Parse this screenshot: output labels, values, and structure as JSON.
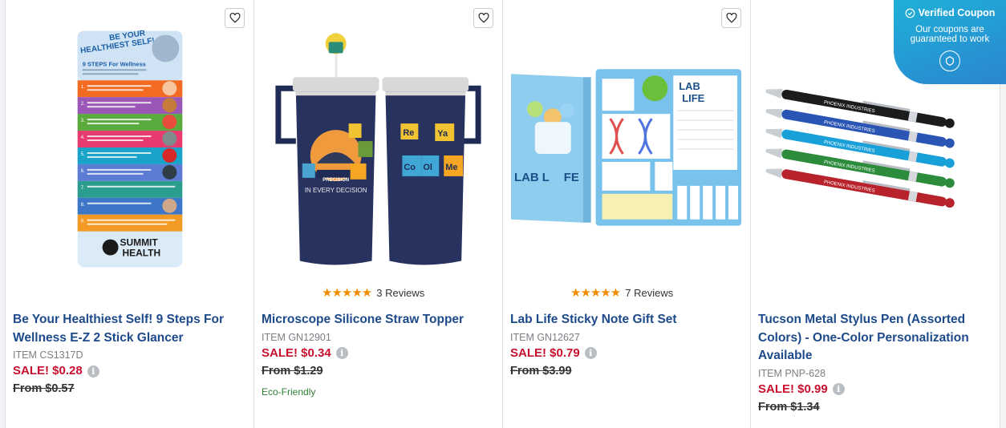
{
  "products": [
    {
      "title": "Be Your Healthiest Self! 9 Steps For Wellness E-Z 2 Stick Glancer",
      "item": "ITEM CS1317D",
      "sale": "SALE! $0.28",
      "from": "From $0.57"
    },
    {
      "title": "Microscope Silicone Straw Topper",
      "item": "ITEM GN12901",
      "sale": "SALE! $0.34",
      "from": "From $1.29",
      "reviews": "3 Reviews",
      "stars": "★★★★★",
      "tag": "Eco-Friendly"
    },
    {
      "title": "Lab Life Sticky Note Gift Set",
      "item": "ITEM GN12627",
      "sale": "SALE! $0.79",
      "from": "From $3.99",
      "reviews": "7 Reviews",
      "stars": "★★★★★"
    },
    {
      "title": "Tucson Metal Stylus Pen (Assorted Colors) - One-Color Personalization Available",
      "item": "ITEM PNP-628",
      "sale": "SALE! $0.99",
      "from": "From $1.34"
    }
  ],
  "glancer": {
    "title_1": "BE YOUR",
    "title_2": "HEALTHIEST SELF!",
    "subtitle": "9 STEPS For Wellness",
    "steps": [
      "1.",
      "2.",
      "3.",
      "4.",
      "5.",
      "6.",
      "7.",
      "8.",
      "9."
    ],
    "brand_1": "SUMMIT",
    "brand_2": "HEALTH"
  },
  "tumbler": {
    "text_1": "PRECISION",
    "text_2": "IN EVERY DECISION",
    "tiles": [
      "Re",
      "Ya",
      "Co",
      "Ol",
      "Me"
    ]
  },
  "notes": {
    "cover_1": "LAB L",
    "cover_2": "FE",
    "pad_1": "LAB",
    "pad_2": "LIFE"
  },
  "pens": {
    "brand": "PHOENIX",
    "brand_suffix": "INDUSTRIES",
    "colors": [
      "#1c1c1c",
      "#2a55b5",
      "#1aa0d8",
      "#2c8c3c",
      "#b8232b"
    ]
  },
  "coupon": {
    "title": "Verified Coupon",
    "message": "Our coupons are guaranteed to work"
  },
  "colors": {
    "title_blue": "#1d4a8a",
    "sale_red": "#c8102e",
    "star_orange": "#f08c00",
    "eco_green": "#2e7d32",
    "coupon_blue": "#1fb0d8"
  },
  "icons": {
    "favorite": "heart-outline-icon",
    "info": "info-circle-icon",
    "coupon_check": "check-circle-icon",
    "coupon_badge": "shield-badge-icon"
  }
}
